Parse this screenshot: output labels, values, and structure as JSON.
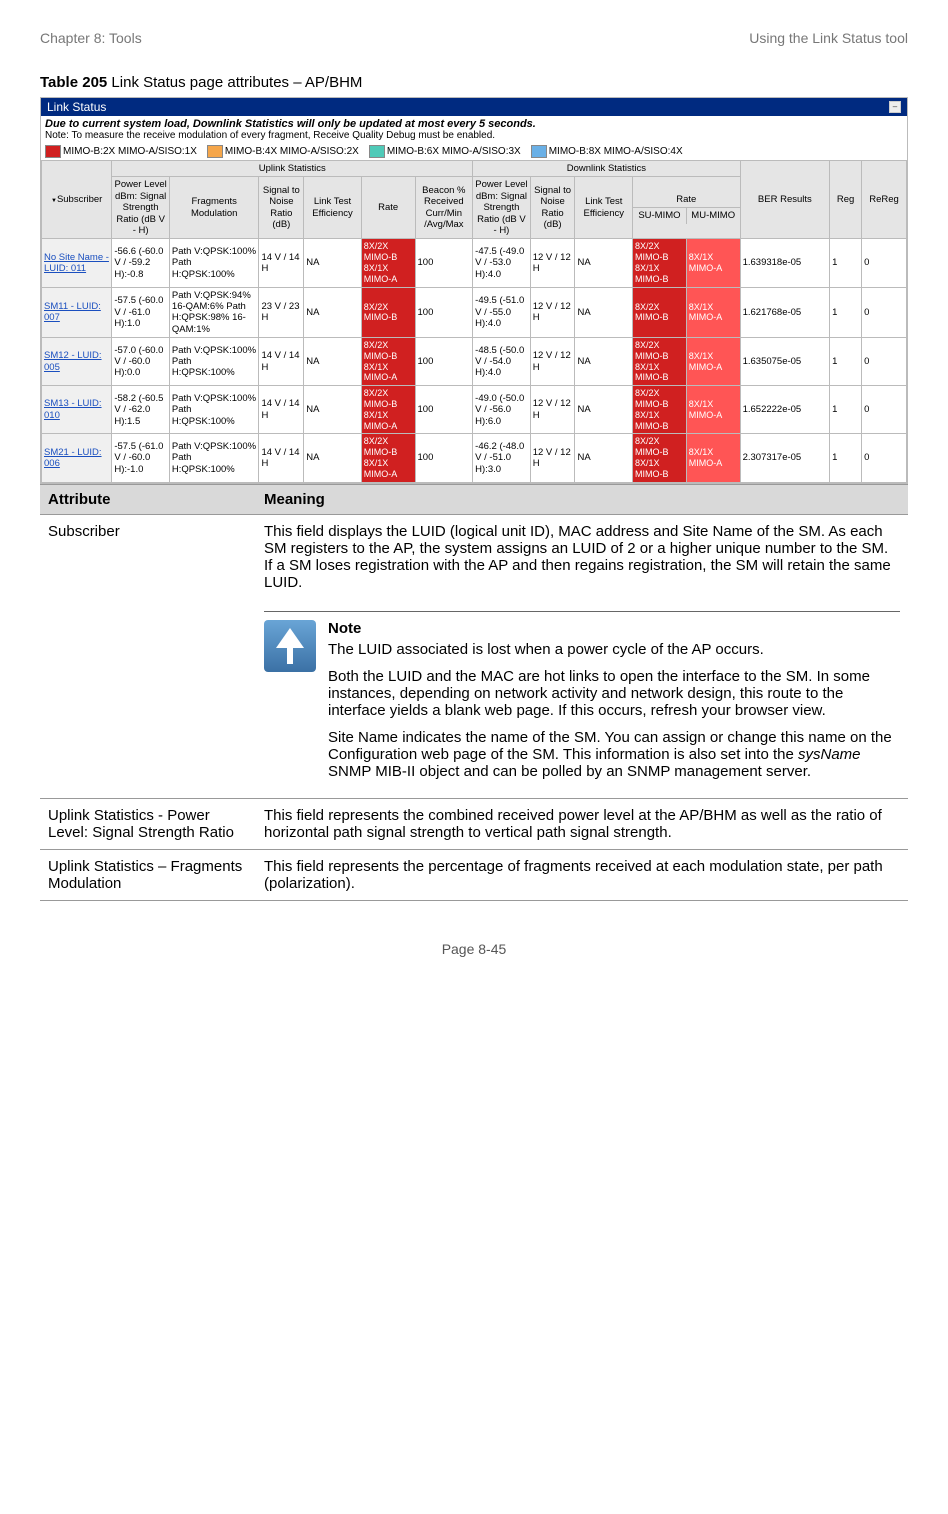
{
  "header": {
    "left": "Chapter 8:  Tools",
    "right": "Using the Link Status tool"
  },
  "caption": {
    "bold": "Table 205",
    "rest": " Link Status page attributes – AP/BHM"
  },
  "ls": {
    "title": "Link Status",
    "warn": "Due to current system load, Downlink Statistics will only be updated at most every 5 seconds.",
    "note": "Note: To measure the receive modulation of every fragment, Receive Quality Debug must be enabled.",
    "legend": [
      {
        "color": "#d02020",
        "label": "MIMO-B:2X MIMO-A/SISO:1X"
      },
      {
        "color": "#f5a64a",
        "label": "MIMO-B:4X MIMO-A/SISO:2X"
      },
      {
        "color": "#4fcab8",
        "label": "MIMO-B:6X MIMO-A/SISO:3X"
      },
      {
        "color": "#6ab0e6",
        "label": "MIMO-B:8X MIMO-A/SISO:4X"
      }
    ],
    "group_headers": {
      "uplink": "Uplink Statistics",
      "downlink": "Downlink Statistics"
    },
    "cols": {
      "subscriber": "Subscriber",
      "ul_power": "Power Level dBm: Signal Strength Ratio (dB V - H)",
      "ul_frag": "Fragments Modulation",
      "ul_snr": "Signal to Noise Ratio (dB)",
      "ul_lte": "Link Test Efficiency",
      "ul_rate": "Rate",
      "ul_beacon": "Beacon % Received Curr/Min /Avg/Max",
      "dl_power": "Power Level dBm: Signal Strength Ratio (dB V - H)",
      "dl_snr": "Signal to Noise Ratio (dB)",
      "dl_lte": "Link Test Efficiency",
      "dl_rate": "Rate",
      "dl_rate_su": "SU-MIMO",
      "dl_rate_mu": "MU-MIMO",
      "ber": "BER Results",
      "reg": "Reg",
      "rereg": "ReReg"
    },
    "rows": [
      {
        "sub": "No Site Name - LUID: 011",
        "ulp": "-56.6 (-60.0 V / -59.2 H):-0.8",
        "ulf": "Path V:QPSK:100% Path H:QPSK:100%",
        "uls": "14 V / 14 H",
        "ull": "NA",
        "ulr": "8X/2X MIMO-B 8X/1X MIMO-A",
        "ulb": "100",
        "dlp": "-47.5 (-49.0 V / -53.0 H):4.0",
        "dls": "12 V / 12 H",
        "dll": "NA",
        "dlrs": "8X/2X MIMO-B 8X/1X MIMO-B",
        "dlrm": "8X/1X MIMO-A",
        "ber": "1.639318e-05",
        "reg": "1",
        "rereg": "0"
      },
      {
        "sub": "SM11 - LUID: 007",
        "ulp": "-57.5 (-60.0 V / -61.0 H):1.0",
        "ulf": "Path V:QPSK:94% 16-QAM:6% Path H:QPSK:98% 16-QAM:1%",
        "uls": "23 V / 23 H",
        "ull": "NA",
        "ulr": "8X/2X MIMO-B",
        "ulb": "100",
        "dlp": "-49.5 (-51.0 V / -55.0 H):4.0",
        "dls": "12 V / 12 H",
        "dll": "NA",
        "dlrs": "8X/2X MIMO-B",
        "dlrm": "8X/1X MIMO-A",
        "ber": "1.621768e-05",
        "reg": "1",
        "rereg": "0"
      },
      {
        "sub": "SM12 - LUID: 005",
        "ulp": "-57.0 (-60.0 V / -60.0 H):0.0",
        "ulf": "Path V:QPSK:100% Path H:QPSK:100%",
        "uls": "14 V / 14 H",
        "ull": "NA",
        "ulr": "8X/2X MIMO-B 8X/1X MIMO-A",
        "ulb": "100",
        "dlp": "-48.5 (-50.0 V / -54.0 H):4.0",
        "dls": "12 V / 12 H",
        "dll": "NA",
        "dlrs": "8X/2X MIMO-B 8X/1X MIMO-B",
        "dlrm": "8X/1X MIMO-A",
        "ber": "1.635075e-05",
        "reg": "1",
        "rereg": "0"
      },
      {
        "sub": "SM13 - LUID: 010",
        "ulp": "-58.2 (-60.5 V / -62.0 H):1.5",
        "ulf": "Path V:QPSK:100% Path H:QPSK:100%",
        "uls": "14 V / 14 H",
        "ull": "NA",
        "ulr": "8X/2X MIMO-B 8X/1X MIMO-A",
        "ulb": "100",
        "dlp": "-49.0 (-50.0 V / -56.0 H):6.0",
        "dls": "12 V / 12 H",
        "dll": "NA",
        "dlrs": "8X/2X MIMO-B 8X/1X MIMO-B",
        "dlrm": "8X/1X MIMO-A",
        "ber": "1.652222e-05",
        "reg": "1",
        "rereg": "0"
      },
      {
        "sub": "SM21 - LUID: 006",
        "ulp": "-57.5 (-61.0 V / -60.0 H):-1.0",
        "ulf": "Path V:QPSK:100% Path H:QPSK:100%",
        "uls": "14 V / 14 H",
        "ull": "NA",
        "ulr": "8X/2X MIMO-B 8X/1X MIMO-A",
        "ulb": "100",
        "dlp": "-46.2 (-48.0 V / -51.0 H):3.0",
        "dls": "12 V / 12 H",
        "dll": "NA",
        "dlrs": "8X/2X MIMO-B 8X/1X MIMO-B",
        "dlrm": "8X/1X MIMO-A",
        "ber": "2.307317e-05",
        "reg": "1",
        "rereg": "0"
      }
    ]
  },
  "attrs_header": {
    "a": "Attribute",
    "b": "Meaning"
  },
  "attrs": {
    "r1a": "Subscriber",
    "r1b": "This field displays the LUID (logical unit ID), MAC address and Site Name of the SM. As each SM registers to the AP, the system assigns an LUID of 2 or a higher unique number to the SM. If a SM loses registration with the AP and then regains registration, the SM will retain the same LUID.",
    "note_title": "Note",
    "note_p1": "The LUID associated is lost when a power cycle of the AP occurs.",
    "note_p2": "Both the LUID and the MAC are hot links to open the interface to the SM. In some instances, depending on network activity and network design, this route to the interface yields a blank web page. If this occurs, refresh your browser view.",
    "note_p3a": "Site Name indicates the name of the SM. You can assign or change this name on the Configuration web page of the SM. This information is also set into the ",
    "note_p3_em": "sysName",
    "note_p3b": " SNMP MIB-II object and can be polled by an SNMP management server.",
    "r2a": "Uplink Statistics - Power Level: Signal Strength Ratio",
    "r2b": "This field represents the combined received power level at the AP/BHM as well as the ratio of horizontal path signal strength to vertical path signal strength.",
    "r3a": "Uplink Statistics – Fragments Modulation",
    "r3b": "This field represents the percentage of fragments received at each modulation state, per path (polarization)."
  },
  "footer": "Page 8-45"
}
